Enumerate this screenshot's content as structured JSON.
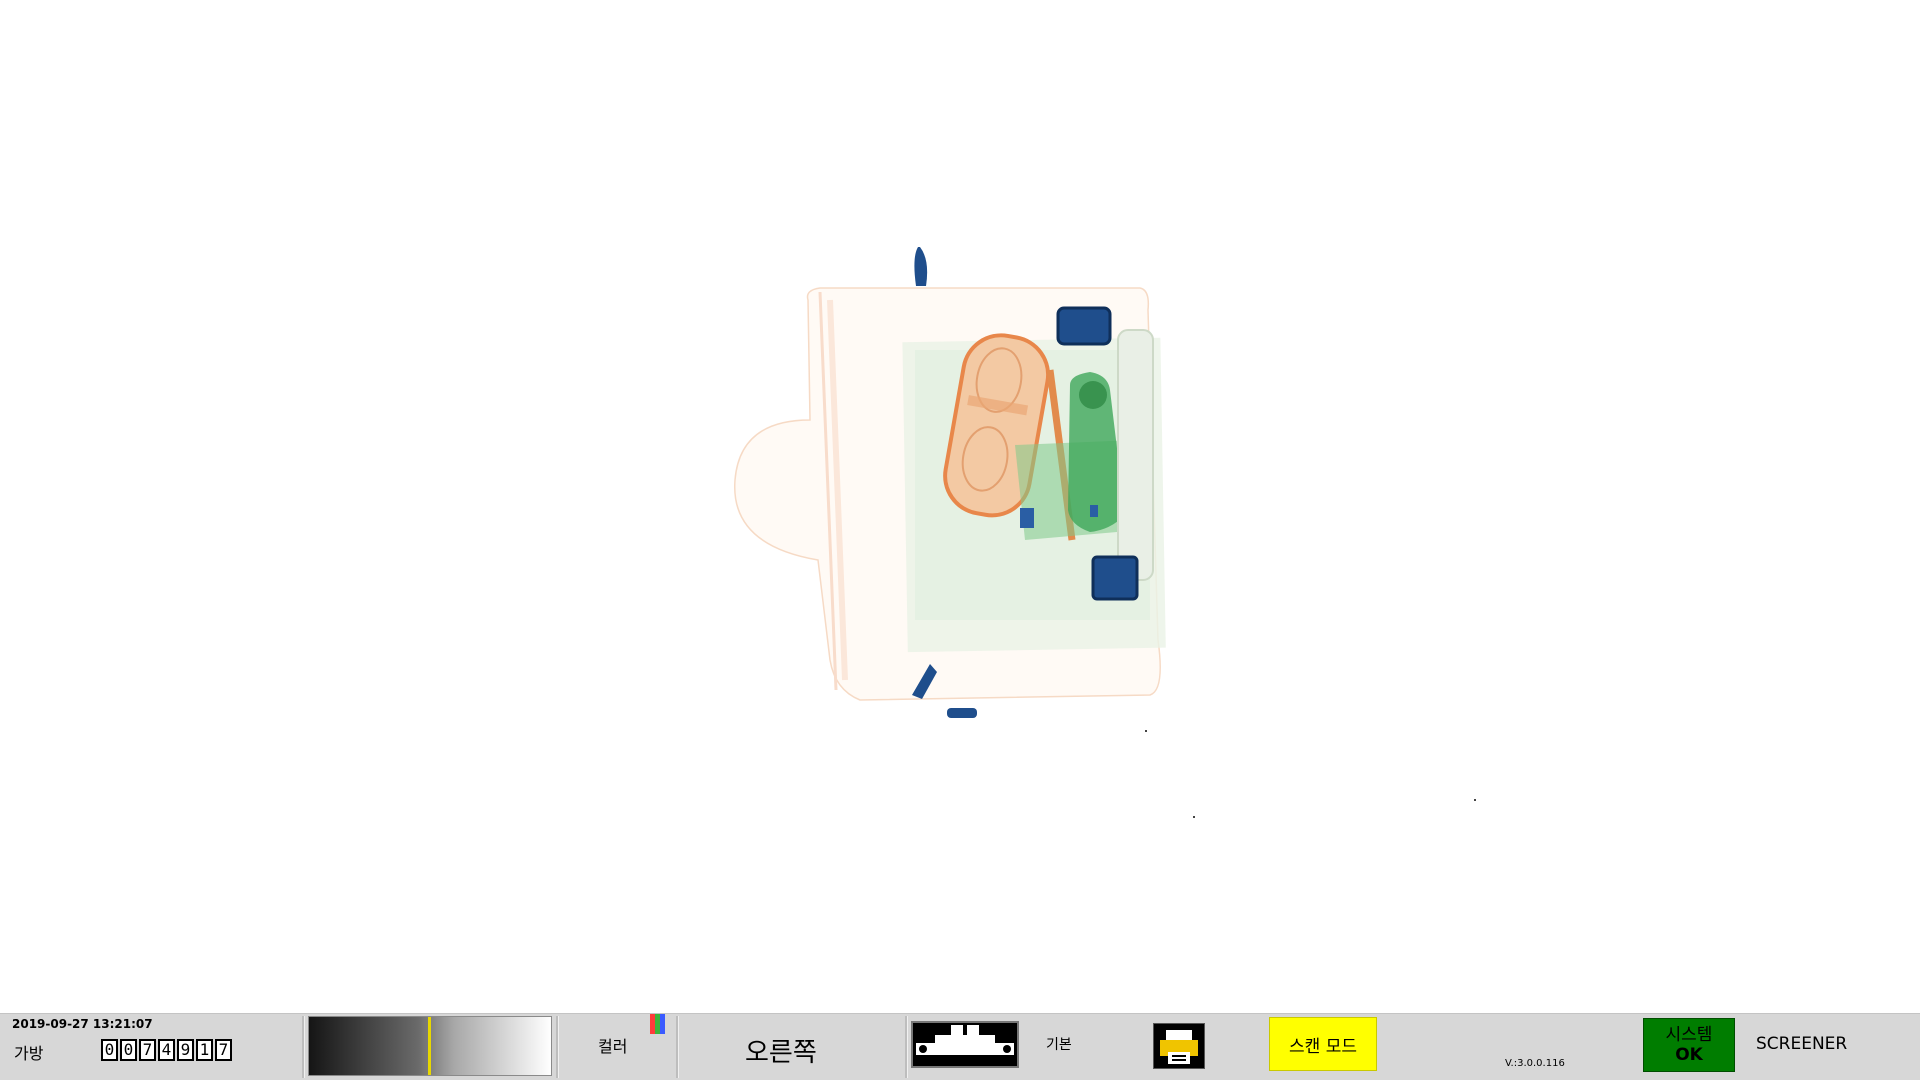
{
  "scan": {
    "image": "x-ray scan of a bag"
  },
  "statusbar": {
    "datetime": "2019-09-27 13:21:07",
    "bag_label": "가방",
    "bag_counter": [
      "0",
      "0",
      "7",
      "4",
      "9",
      "1",
      "7"
    ],
    "gradient_level": 0.5,
    "color_label": "컬러",
    "color_icon_colors": [
      "#ff3b3b",
      "#3cb53c",
      "#3a5bff"
    ],
    "side_label": "오른쪽",
    "basic_label": "기본",
    "scan_mode_label": "스캔 모드",
    "version": "V.:3.0.0.116",
    "system_label": "시스템",
    "system_status": "OK",
    "user_role": "SCREENER"
  },
  "colors": {
    "status_ok": "#007d00",
    "scan_mode": "#ffff00",
    "organic": "#e8874a",
    "inorganic": "#3fa85a",
    "metal": "#1f4e8c"
  }
}
